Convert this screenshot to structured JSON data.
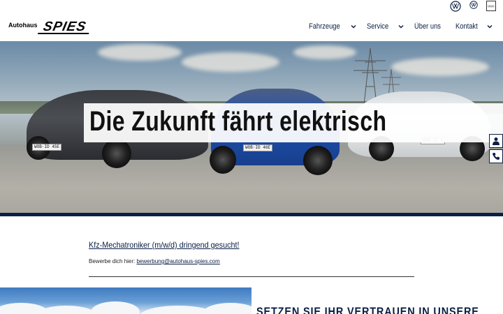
{
  "header": {
    "logo_small": "Autohaus",
    "logo_big": "SPIES",
    "nav": [
      {
        "label": "Fahrzeuge",
        "has_dropdown": true
      },
      {
        "label": "Service",
        "has_dropdown": true
      },
      {
        "label": "Über uns",
        "has_dropdown": false
      },
      {
        "label": "Kontakt",
        "has_dropdown": true
      }
    ],
    "brands": [
      "vw-logo",
      "vw-nutzfahrzeuge-logo",
      "audi-logo"
    ]
  },
  "hero": {
    "headline": "Die Zukunft fährt elektrisch",
    "plates": [
      "WOB·ID 45E",
      "WOB·ID 46E",
      "WOB·ID 4"
    ]
  },
  "side_actions": [
    "person-icon",
    "phone-icon"
  ],
  "job": {
    "title": "Kfz-Mechatroniker (m/w/d) dringend gesucht!",
    "apply_prefix": "Bewerbe dich hier: ",
    "apply_email": "bewerbung@autohaus-spies.com"
  },
  "section": {
    "heading": "SETZEN SIE IHR VERTRAUEN IN UNSERE"
  },
  "colors": {
    "navy": "#0a1f44",
    "white": "#ffffff"
  }
}
